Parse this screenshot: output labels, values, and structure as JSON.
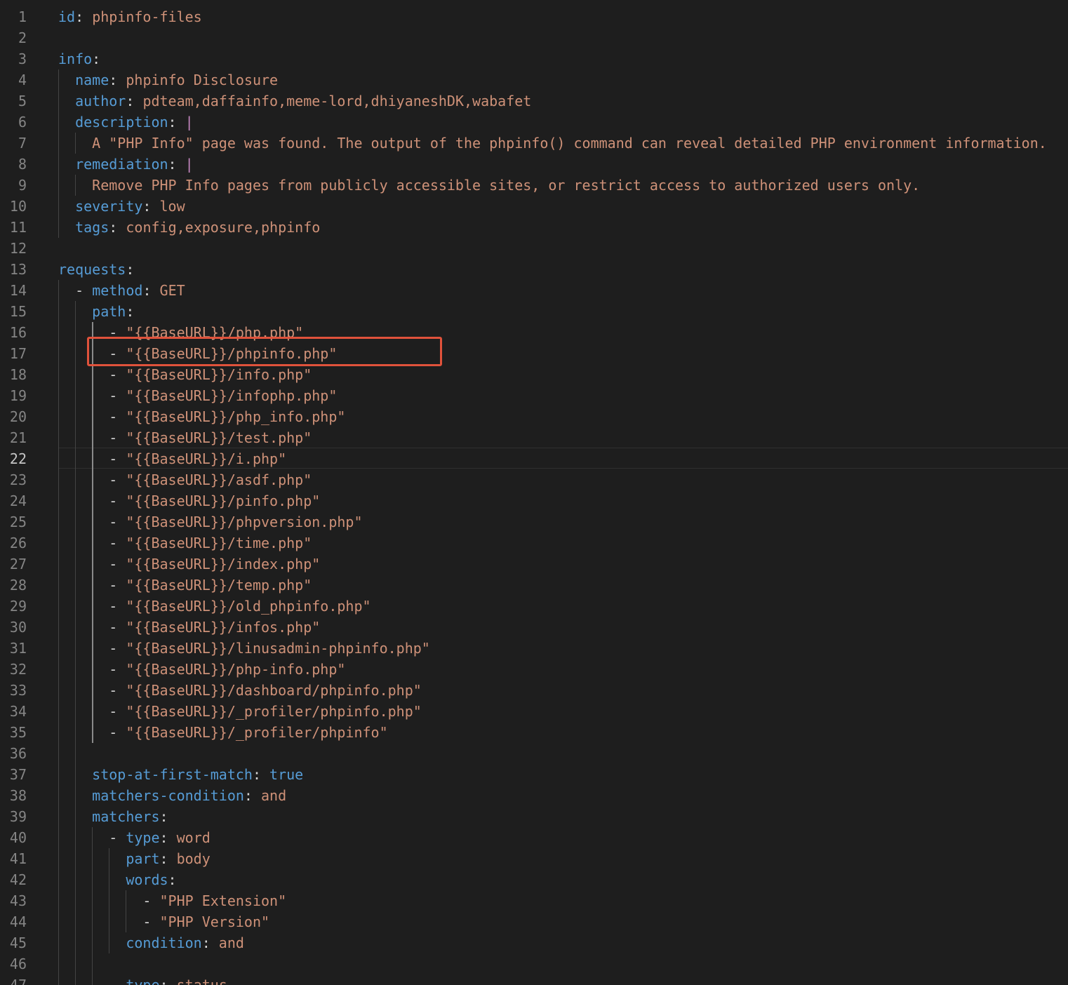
{
  "editor": {
    "language": "yaml",
    "current_line": 22,
    "colors": {
      "background": "#1e1e1e",
      "key": "#569cd6",
      "value": "#ce9178",
      "line_number": "#858585",
      "highlight_box": "#e0523b"
    },
    "lines": [
      {
        "n": 1,
        "indent": 0,
        "key": "id",
        "value": "phpinfo-files"
      },
      {
        "n": 2,
        "blank": true
      },
      {
        "n": 3,
        "indent": 0,
        "key": "info"
      },
      {
        "n": 4,
        "indent": 1,
        "key": "name",
        "value": "phpinfo Disclosure"
      },
      {
        "n": 5,
        "indent": 1,
        "key": "author",
        "value": "pdteam,daffainfo,meme-lord,dhiyaneshDK,wabafet"
      },
      {
        "n": 6,
        "indent": 1,
        "key": "description",
        "pipe": "|"
      },
      {
        "n": 7,
        "indent": 2,
        "text": "A \"PHP Info\" page was found. The output of the phpinfo() command can reveal detailed PHP environment information."
      },
      {
        "n": 8,
        "indent": 1,
        "key": "remediation",
        "pipe": "|"
      },
      {
        "n": 9,
        "indent": 2,
        "text": "Remove PHP Info pages from publicly accessible sites, or restrict access to authorized users only."
      },
      {
        "n": 10,
        "indent": 1,
        "key": "severity",
        "value": "low"
      },
      {
        "n": 11,
        "indent": 1,
        "key": "tags",
        "value": "config,exposure,phpinfo"
      },
      {
        "n": 12,
        "blank": true
      },
      {
        "n": 13,
        "indent": 0,
        "key": "requests"
      },
      {
        "n": 14,
        "indent": 1,
        "dash": true,
        "key": "method",
        "value": "GET"
      },
      {
        "n": 15,
        "indent": 2,
        "key": "path"
      },
      {
        "n": 16,
        "indent": 3,
        "dash": true,
        "text": "\"{{BaseURL}}/php.php\""
      },
      {
        "n": 17,
        "indent": 3,
        "dash": true,
        "text": "\"{{BaseURL}}/phpinfo.php\""
      },
      {
        "n": 18,
        "indent": 3,
        "dash": true,
        "text": "\"{{BaseURL}}/info.php\""
      },
      {
        "n": 19,
        "indent": 3,
        "dash": true,
        "text": "\"{{BaseURL}}/infophp.php\""
      },
      {
        "n": 20,
        "indent": 3,
        "dash": true,
        "text": "\"{{BaseURL}}/php_info.php\""
      },
      {
        "n": 21,
        "indent": 3,
        "dash": true,
        "text": "\"{{BaseURL}}/test.php\""
      },
      {
        "n": 22,
        "indent": 3,
        "dash": true,
        "text": "\"{{BaseURL}}/i.php\""
      },
      {
        "n": 23,
        "indent": 3,
        "dash": true,
        "text": "\"{{BaseURL}}/asdf.php\""
      },
      {
        "n": 24,
        "indent": 3,
        "dash": true,
        "text": "\"{{BaseURL}}/pinfo.php\""
      },
      {
        "n": 25,
        "indent": 3,
        "dash": true,
        "text": "\"{{BaseURL}}/phpversion.php\""
      },
      {
        "n": 26,
        "indent": 3,
        "dash": true,
        "text": "\"{{BaseURL}}/time.php\""
      },
      {
        "n": 27,
        "indent": 3,
        "dash": true,
        "text": "\"{{BaseURL}}/index.php\""
      },
      {
        "n": 28,
        "indent": 3,
        "dash": true,
        "text": "\"{{BaseURL}}/temp.php\""
      },
      {
        "n": 29,
        "indent": 3,
        "dash": true,
        "text": "\"{{BaseURL}}/old_phpinfo.php\""
      },
      {
        "n": 30,
        "indent": 3,
        "dash": true,
        "text": "\"{{BaseURL}}/infos.php\""
      },
      {
        "n": 31,
        "indent": 3,
        "dash": true,
        "text": "\"{{BaseURL}}/linusadmin-phpinfo.php\""
      },
      {
        "n": 32,
        "indent": 3,
        "dash": true,
        "text": "\"{{BaseURL}}/php-info.php\""
      },
      {
        "n": 33,
        "indent": 3,
        "dash": true,
        "text": "\"{{BaseURL}}/dashboard/phpinfo.php\""
      },
      {
        "n": 34,
        "indent": 3,
        "dash": true,
        "text": "\"{{BaseURL}}/_profiler/phpinfo.php\""
      },
      {
        "n": 35,
        "indent": 3,
        "dash": true,
        "text": "\"{{BaseURL}}/_profiler/phpinfo\""
      },
      {
        "n": 36,
        "blank": true
      },
      {
        "n": 37,
        "indent": 2,
        "key": "stop-at-first-match",
        "value": "true",
        "value_is_keyword": true
      },
      {
        "n": 38,
        "indent": 2,
        "key": "matchers-condition",
        "value": "and"
      },
      {
        "n": 39,
        "indent": 2,
        "key": "matchers"
      },
      {
        "n": 40,
        "indent": 3,
        "dash": true,
        "key": "type",
        "value": "word"
      },
      {
        "n": 41,
        "indent": 4,
        "key": "part",
        "value": "body"
      },
      {
        "n": 42,
        "indent": 4,
        "key": "words"
      },
      {
        "n": 43,
        "indent": 5,
        "dash": true,
        "text": "\"PHP Extension\""
      },
      {
        "n": 44,
        "indent": 5,
        "dash": true,
        "text": "\"PHP Version\""
      },
      {
        "n": 45,
        "indent": 4,
        "key": "condition",
        "value": "and"
      },
      {
        "n": 46,
        "blank": true
      },
      {
        "n": 47,
        "indent": 3,
        "dash": true,
        "key": "type",
        "value": "status"
      }
    ]
  }
}
